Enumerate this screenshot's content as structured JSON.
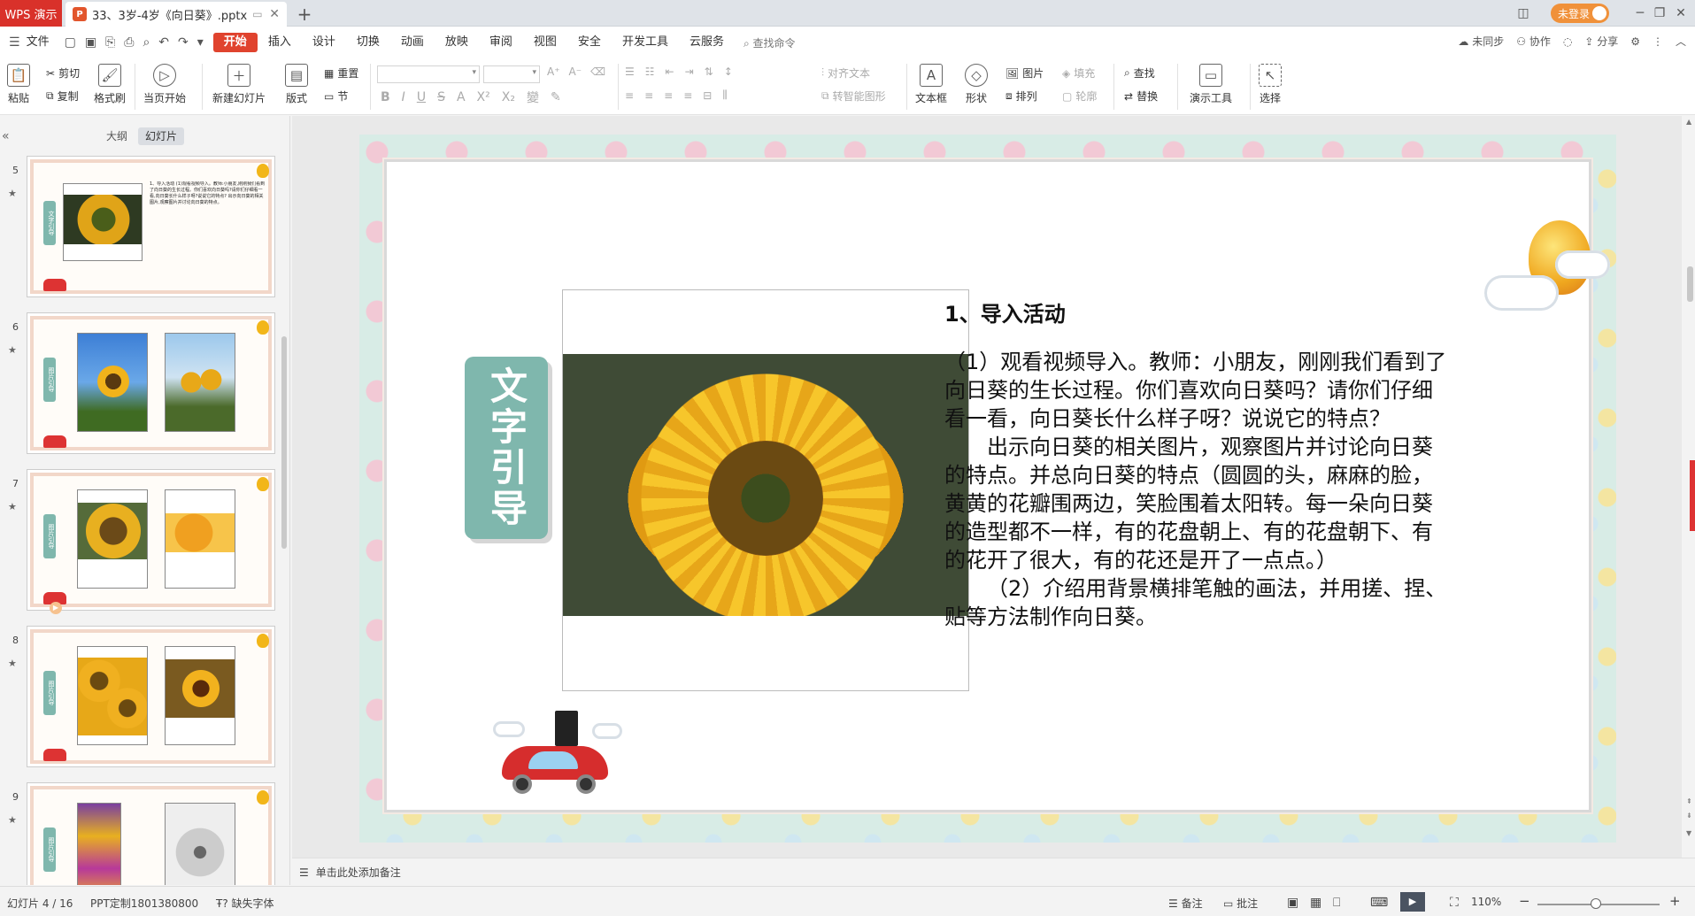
{
  "titlebar": {
    "app_name": "WPS 演示",
    "doc_icon": "P",
    "doc_title": "33、3岁-4岁《向日葵》.pptx",
    "new_tab": "+",
    "login": "未登录"
  },
  "menubar": {
    "file": "文件",
    "tabs": [
      "开始",
      "插入",
      "设计",
      "切换",
      "动画",
      "放映",
      "审阅",
      "视图",
      "安全",
      "开发工具",
      "云服务"
    ],
    "active_tab": "开始",
    "search_placeholder": "查找命令",
    "right": {
      "sync": "未同步",
      "collab": "协作",
      "share": "分享"
    }
  },
  "ribbon": {
    "paste": "粘贴",
    "cut": "剪切",
    "copy": "复制",
    "format_painter": "格式刷",
    "from_current": "当页开始",
    "new_slide": "新建幻灯片",
    "layout": "版式",
    "reset": "重置",
    "section": "节",
    "align_text": "对齐文本",
    "smart_art": "转智能图形",
    "textbox": "文本框",
    "shape": "形状",
    "picture": "图片",
    "arrange": "排列",
    "fill": "填充",
    "outline": "轮廓",
    "find": "查找",
    "replace": "替换",
    "presenter_tools": "演示工具",
    "select": "选择"
  },
  "left_panel": {
    "tabs": [
      "大纲",
      "幻灯片"
    ],
    "active_tab": "幻灯片",
    "thumbnails": [
      {
        "num": "5",
        "label": "文字引导",
        "text": "1、导入活动 (1)观看视频导入。教师:小朋友,刚刚我们看到了向日葵的生长过程。你们喜欢向日葵吗?请你们仔细看一看,向日葵长什么样子呀?说说它的特点? 出示向日葵的相关图片,观察图片并讨论向日葵的特点。"
      },
      {
        "num": "6",
        "label": "图片引导"
      },
      {
        "num": "7",
        "label": "图片引导"
      },
      {
        "num": "8",
        "label": "图片引导"
      },
      {
        "num": "9",
        "label": "图片引导"
      }
    ]
  },
  "slide": {
    "label": "文字引导",
    "heading": "1、导入活动",
    "paragraphs": [
      "（1）观看视频导入。教师：小朋友，刚刚我们看到了向日葵的生长过程。你们喜欢向日葵吗？请你们仔细看一看，向日葵长什么样子呀？说说它的特点？",
      "出示向日葵的相关图片，观察图片并讨论向日葵的特点。并总向日葵的特点（圆圆的头，麻麻的脸，黄黄的花瓣围两边，笑脸围着太阳转。每一朵向日葵的造型都不一样，有的花盘朝上、有的花盘朝下、有的花开了很大，有的花还是开了一点点。）",
      "（2）介绍用背景横排笔触的画法，并用搓、捏、贴等方法制作向日葵。"
    ]
  },
  "notes": {
    "placeholder": "单击此处添加备注"
  },
  "statusbar": {
    "slide_info": "幻灯片 4 / 16",
    "template": "PPT定制1801380800",
    "missing_font": "缺失字体",
    "notes": "备注",
    "comments": "批注",
    "zoom": "110%",
    "zoom_level": 0.48
  }
}
